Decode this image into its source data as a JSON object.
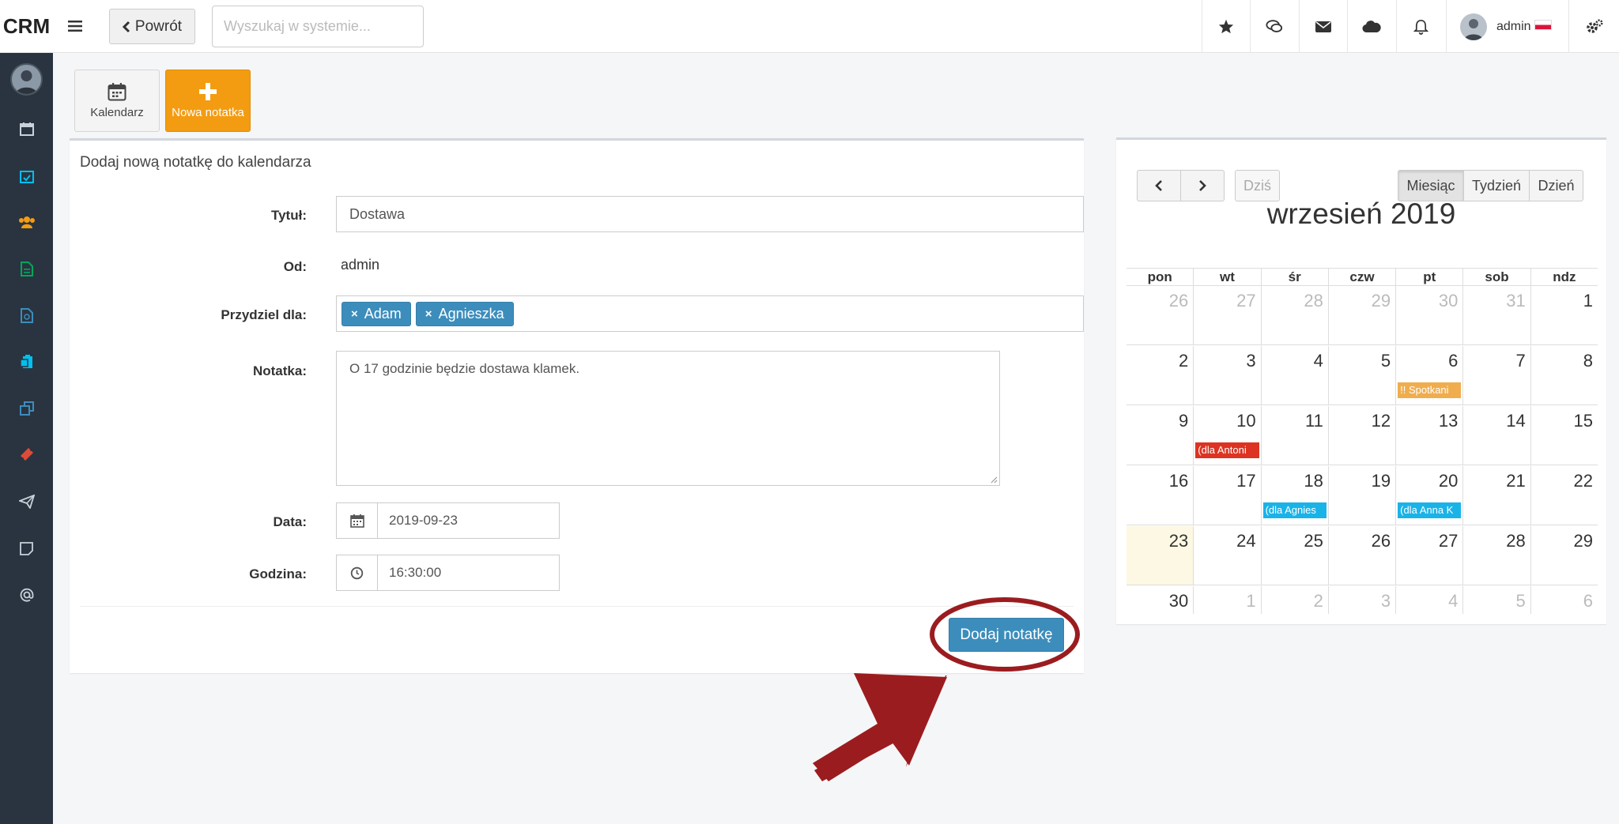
{
  "app": {
    "logo": "CRM"
  },
  "topbar": {
    "back_label": "Powrót",
    "search_placeholder": "Wyszukaj w systemie...",
    "user_name": "admin"
  },
  "tiles": {
    "calendar": "Kalendarz",
    "new_note": "Nowa notatka"
  },
  "form": {
    "title": "Dodaj nową notatkę do kalendarza",
    "labels": {
      "title": "Tytuł:",
      "from": "Od:",
      "assign": "Przydziel dla:",
      "note": "Notatka:",
      "date": "Data:",
      "time": "Godzina:"
    },
    "values": {
      "title": "Dostawa",
      "from": "admin",
      "assignees": [
        "Adam",
        "Agnieszka"
      ],
      "note": "O 17 godzinie będzie dostawa klamek.",
      "date": "2019-09-23",
      "time": "16:30:00"
    },
    "tag_remove": "×",
    "submit_label": "Dodaj notatkę"
  },
  "calendar": {
    "today_label": "Dziś",
    "views": [
      "Miesiąc",
      "Tydzień",
      "Dzień"
    ],
    "active_view": "Miesiąc",
    "month_title": "wrzesień 2019",
    "weekdays": [
      "pon",
      "wt",
      "śr",
      "czw",
      "pt",
      "sob",
      "ndz"
    ],
    "weeks": [
      [
        {
          "d": "26",
          "o": true
        },
        {
          "d": "27",
          "o": true
        },
        {
          "d": "28",
          "o": true
        },
        {
          "d": "29",
          "o": true
        },
        {
          "d": "30",
          "o": true
        },
        {
          "d": "31",
          "o": true
        },
        {
          "d": "1"
        }
      ],
      [
        {
          "d": "2"
        },
        {
          "d": "3"
        },
        {
          "d": "4"
        },
        {
          "d": "5"
        },
        {
          "d": "6",
          "ev": "!! Spotkani",
          "c": "#f0ad4e"
        },
        {
          "d": "7"
        },
        {
          "d": "8"
        }
      ],
      [
        {
          "d": "9"
        },
        {
          "d": "10",
          "ev": "(dla Antoni",
          "c": "#dd3322"
        },
        {
          "d": "11"
        },
        {
          "d": "12"
        },
        {
          "d": "13"
        },
        {
          "d": "14"
        },
        {
          "d": "15"
        }
      ],
      [
        {
          "d": "16"
        },
        {
          "d": "17"
        },
        {
          "d": "18",
          "ev": "(dla Agnies",
          "c": "#1ab3e8"
        },
        {
          "d": "19"
        },
        {
          "d": "20",
          "ev": "(dla Anna K",
          "c": "#1ab3e8"
        },
        {
          "d": "21"
        },
        {
          "d": "22"
        }
      ],
      [
        {
          "d": "23",
          "today": true
        },
        {
          "d": "24"
        },
        {
          "d": "25"
        },
        {
          "d": "26"
        },
        {
          "d": "27"
        },
        {
          "d": "28"
        },
        {
          "d": "29"
        }
      ],
      [
        {
          "d": "30"
        },
        {
          "d": "1",
          "o": true
        },
        {
          "d": "2",
          "o": true
        },
        {
          "d": "3",
          "o": true
        },
        {
          "d": "4",
          "o": true
        },
        {
          "d": "5",
          "o": true
        },
        {
          "d": "6",
          "o": true
        }
      ]
    ]
  },
  "colors": {
    "sidebar_bg": "#2a3440",
    "primary": "#3c8dbc",
    "orange": "#f39c12",
    "annotation": "#9b1c1f"
  }
}
